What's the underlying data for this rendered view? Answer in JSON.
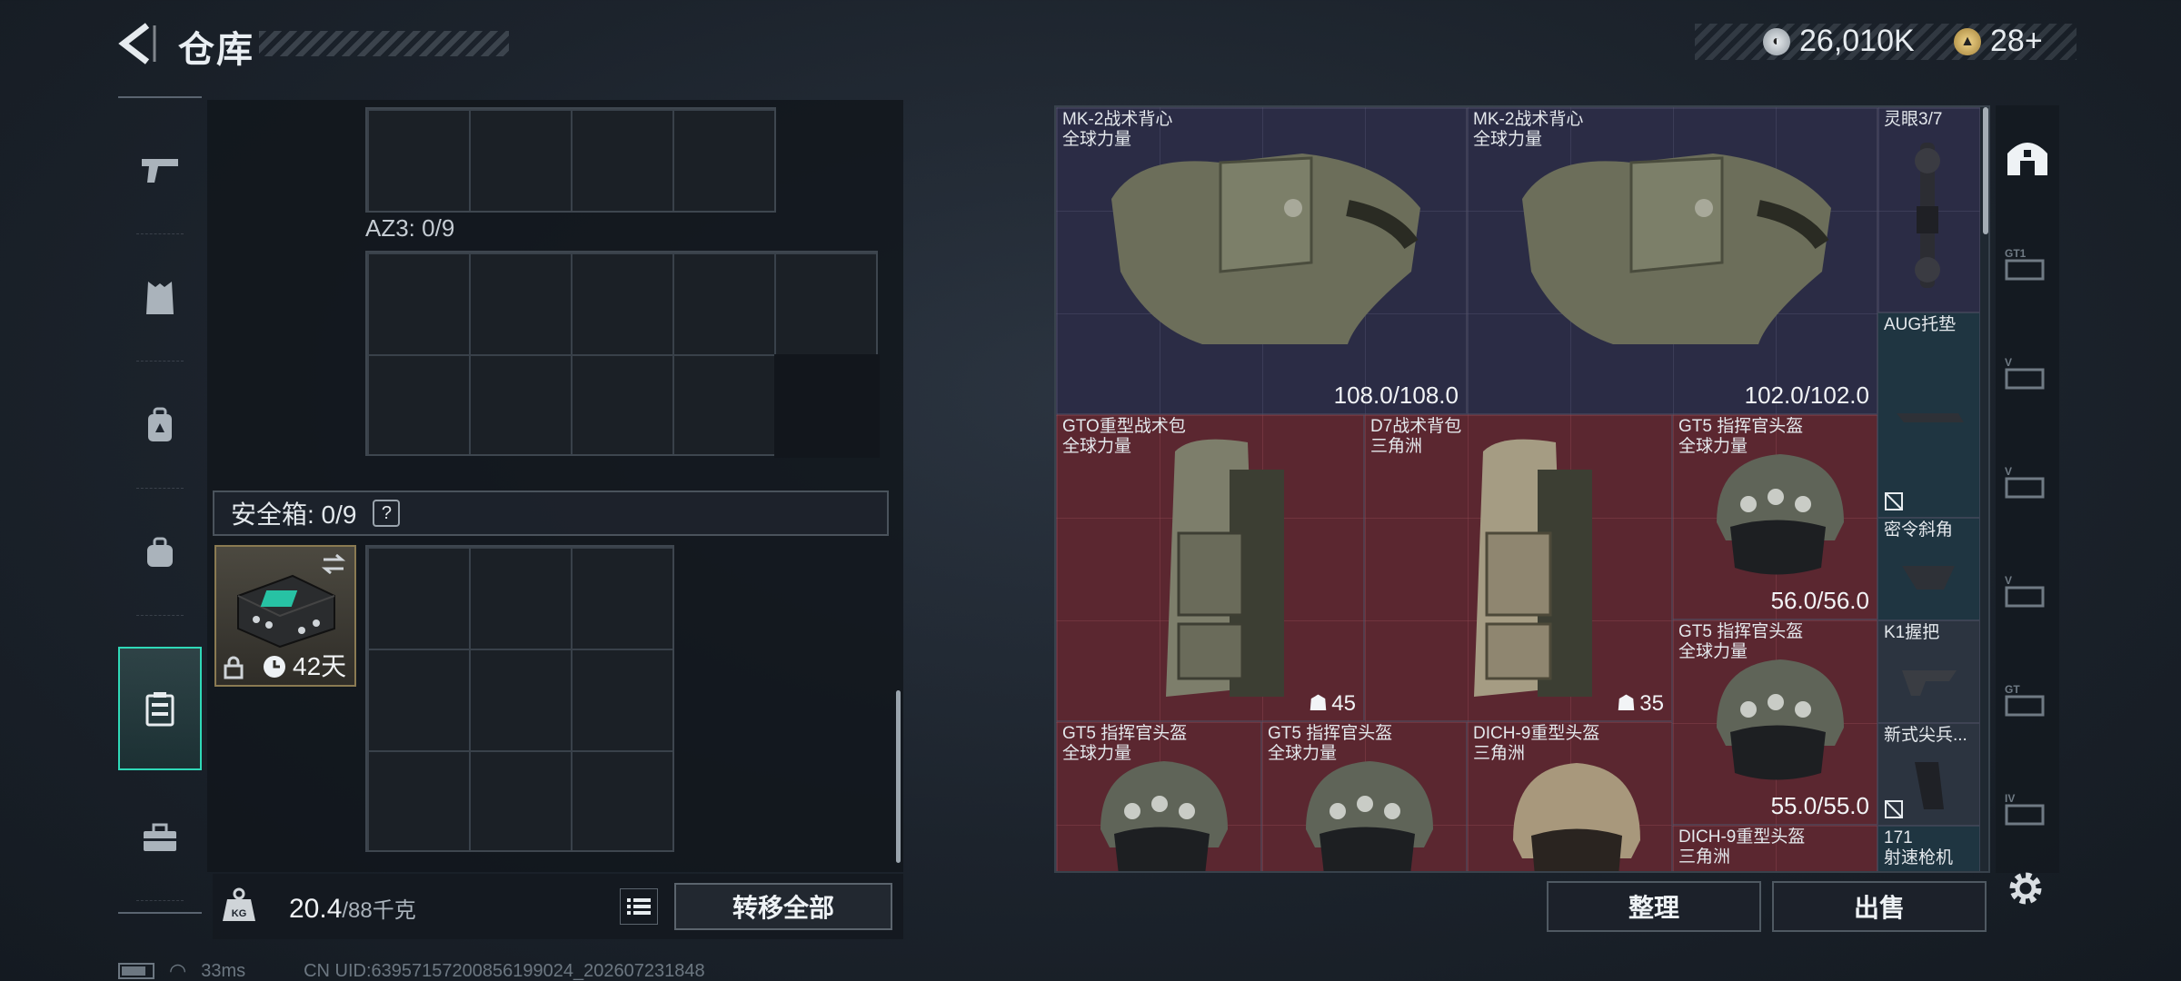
{
  "header": {
    "title": "仓库",
    "currency_main": "26,010K",
    "currency_secondary": "28+"
  },
  "left_nav": {
    "items": [
      "weapons",
      "armor",
      "backpack",
      "bag",
      "safebox",
      "toolbox"
    ],
    "active": "safebox"
  },
  "container": {
    "az3_label": "AZ3: 0/9",
    "safe_label": "安全箱: 0/9",
    "safe_help": "?",
    "safebox_timer": "42天",
    "weight_value": "20.4",
    "weight_max": "/88千克",
    "transfer_all": "转移全部"
  },
  "inventory": {
    "items": [
      {
        "name": "MK-2战术背心",
        "sub": "全球力量",
        "value": "108.0/108.0"
      },
      {
        "name": "MK-2战术背心",
        "sub": "全球力量",
        "value": "102.0/102.0"
      },
      {
        "name": "灵眼3/7",
        "sub": ""
      },
      {
        "name": "AUG托垫",
        "sub": ""
      },
      {
        "name": "GTO重型战术包",
        "sub": "全球力量",
        "qty": "45"
      },
      {
        "name": "D7战术背包",
        "sub": "三角洲",
        "qty": "35"
      },
      {
        "name": "GT5 指挥官头盔",
        "sub": "全球力量",
        "value": "56.0/56.0"
      },
      {
        "name": "密令斜角",
        "sub": ""
      },
      {
        "name": "K1握把",
        "sub": ""
      },
      {
        "name": "GT5 指挥官头盔",
        "sub": "全球力量",
        "value": "55.0/55.0"
      },
      {
        "name": "新式尖兵...",
        "sub": ""
      },
      {
        "name": "GT5 指挥官头盔",
        "sub": "全球力量"
      },
      {
        "name": "GT5 指挥官头盔",
        "sub": "全球力量"
      },
      {
        "name": "DICH-9重型头盔",
        "sub": "三角洲"
      },
      {
        "name": "DICH-9重型头盔",
        "sub": "三角洲"
      },
      {
        "name": "171",
        "sub": "射速枪机"
      }
    ]
  },
  "buttons": {
    "sort": "整理",
    "sell": "出售"
  },
  "status": {
    "ping": "33ms",
    "uid": "CN UID:639571572008561990​24_202607231848"
  },
  "colors": {
    "accent": "#2fd9b8",
    "rare_purple": "#2b2c45",
    "legendary_red": "#5b2730"
  }
}
